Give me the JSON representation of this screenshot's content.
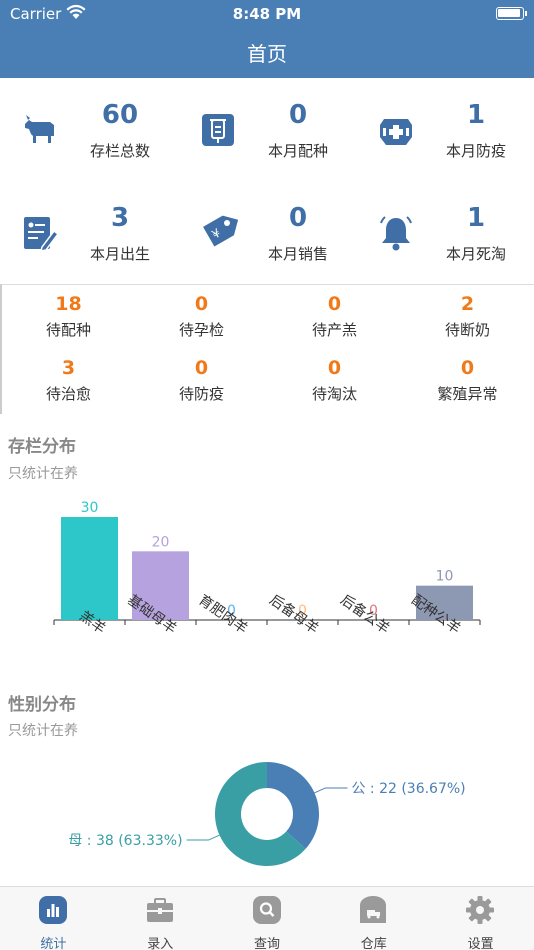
{
  "status": {
    "carrier": "Carrier",
    "time": "8:48 PM"
  },
  "header": {
    "title": "首页"
  },
  "stats": [
    {
      "value": "60",
      "label": "存栏总数",
      "icon": "goat-icon"
    },
    {
      "value": "0",
      "label": "本月配种",
      "icon": "breeding-icon"
    },
    {
      "value": "1",
      "label": "本月防疫",
      "icon": "medical-kit-icon"
    },
    {
      "value": "3",
      "label": "本月出生",
      "icon": "birth-record-icon"
    },
    {
      "value": "0",
      "label": "本月销售",
      "icon": "price-tag-icon"
    },
    {
      "value": "1",
      "label": "本月死淘",
      "icon": "bell-icon"
    }
  ],
  "pending": [
    {
      "value": "18",
      "label": "待配种"
    },
    {
      "value": "0",
      "label": "待孕检"
    },
    {
      "value": "0",
      "label": "待产羔"
    },
    {
      "value": "2",
      "label": "待断奶"
    },
    {
      "value": "3",
      "label": "待治愈"
    },
    {
      "value": "0",
      "label": "待防疫"
    },
    {
      "value": "0",
      "label": "待淘汰"
    },
    {
      "value": "0",
      "label": "繁殖异常"
    }
  ],
  "sections": {
    "stock": {
      "title": "存栏分布",
      "subtitle": "只统计在养"
    },
    "gender": {
      "title": "性别分布",
      "subtitle": "只统计在养"
    }
  },
  "chart_data": [
    {
      "type": "bar",
      "categories": [
        "羔羊",
        "基础母羊",
        "育肥肉羊",
        "后备母羊",
        "后备公羊",
        "配种公羊"
      ],
      "values": [
        30,
        20,
        0,
        0,
        0,
        10
      ],
      "colors": [
        "#2ec7c9",
        "#b6a2de",
        "#5ab1ef",
        "#ffb980",
        "#d87a80",
        "#8d98b3"
      ],
      "ylim": [
        0,
        30
      ]
    },
    {
      "type": "pie",
      "slices": [
        {
          "label": "公 : 22 (36.67%)",
          "value": 22,
          "color": "#4a7fb5"
        },
        {
          "label": "母 : 38 (63.33%)",
          "value": 38,
          "color": "#3a9ea5"
        }
      ]
    }
  ],
  "tabs": [
    {
      "label": "统计",
      "icon": "chart-icon",
      "active": true
    },
    {
      "label": "录入",
      "icon": "briefcase-icon",
      "active": false
    },
    {
      "label": "查询",
      "icon": "search-icon",
      "active": false
    },
    {
      "label": "仓库",
      "icon": "warehouse-icon",
      "active": false
    },
    {
      "label": "设置",
      "icon": "gear-icon",
      "active": false
    }
  ]
}
